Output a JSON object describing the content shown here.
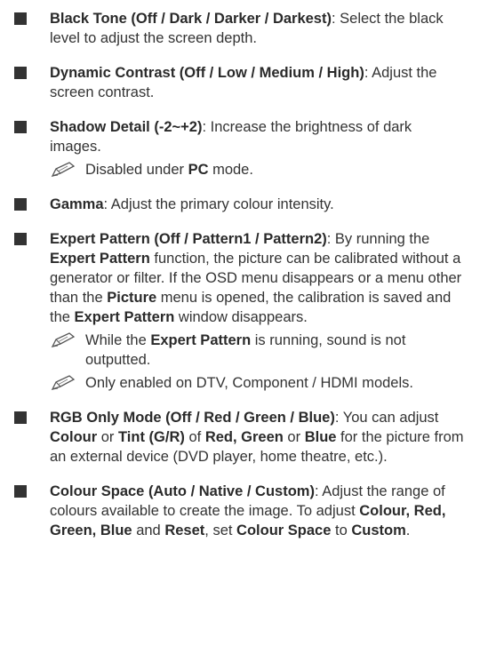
{
  "items": [
    {
      "title": "Black Tone (Off / Dark / Darker / Darkest)",
      "desc": ": Select the black level to adjust the screen depth."
    },
    {
      "title": "Dynamic Contrast (Off / Low / Medium / High)",
      "desc": ": Adjust the screen contrast."
    },
    {
      "title": "Shadow Detail (-2~+2)",
      "desc": ": Increase the brightness of dark images.",
      "note": {
        "pre": "Disabled under ",
        "bold": "PC",
        "post": " mode."
      }
    },
    {
      "title": "Gamma",
      "desc": ": Adjust the primary colour intensity."
    },
    {
      "title": "Expert Pattern (Off / Pattern1 / Pattern2)",
      "desc1": ": By running the ",
      "bold1": "Expert Pattern",
      "desc2": " function, the picture can be calibrated without a generator or filter. If the OSD menu disappears or a menu other than the ",
      "bold2": "Picture",
      "desc3": " menu is opened, the calibration is saved and the ",
      "bold3": "Expert Pattern",
      "desc4": " window disappears.",
      "note1": {
        "pre": "While the ",
        "bold": "Expert Pattern",
        "post": " is running, sound is not outputted."
      },
      "note2": {
        "text": "Only enabled on DTV, Component / HDMI models."
      }
    },
    {
      "title": "RGB Only Mode (Off / Red / Green / Blue)",
      "desc1": ": You can adjust ",
      "bold1": "Colour",
      "desc2": " or ",
      "bold2": "Tint (G/R)",
      "desc3": " of ",
      "bold3": "Red, Green",
      "desc4": " or ",
      "bold4": "Blue",
      "desc5": " for the picture from an external device (DVD player, home theatre, etc.)."
    },
    {
      "title": "Colour Space (Auto / Native / Custom)",
      "desc1": ": Adjust the range of colours available to create the image. To adjust ",
      "bold1": "Colour, Red, Green, Blue",
      "desc2": " and ",
      "bold2": "Reset",
      "desc3": ", set ",
      "bold3": "Colour Space",
      "desc4": " to ",
      "bold4": "Custom",
      "desc5": "."
    }
  ],
  "icons": {
    "bullet": "square-bullet",
    "note": "pencil-note-icon"
  },
  "colors": {
    "text": "#333333",
    "bullet": "#333333"
  }
}
